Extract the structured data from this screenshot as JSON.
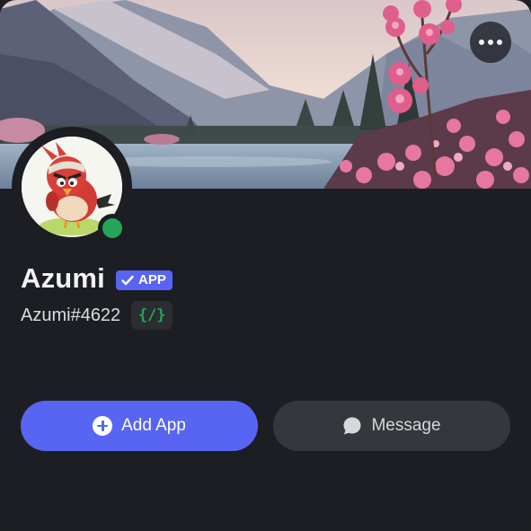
{
  "profile": {
    "display_name": "Azumi",
    "badge_label": "APP",
    "username": "Azumi#4622",
    "dev_badge_glyph": "{/}",
    "status": "online"
  },
  "actions": {
    "add_app_label": "Add App",
    "message_label": "Message"
  },
  "colors": {
    "accent": "#5865f2",
    "online": "#23a55a",
    "background": "#1d1e23",
    "secondary_button": "#35373c"
  },
  "icons": {
    "more": "ellipsis-icon",
    "badge_check": "checkmark-icon",
    "add": "plus-circle-icon",
    "message": "chat-bubble-icon",
    "developer": "code-brackets-icon"
  }
}
